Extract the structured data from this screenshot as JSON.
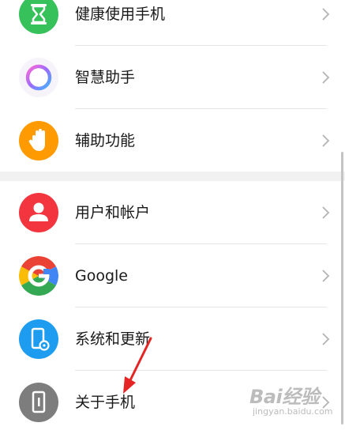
{
  "settings": {
    "items": [
      {
        "label": "健康使用手机",
        "icon": "hourglass-icon",
        "color": "#36c15a"
      },
      {
        "label": "智慧助手",
        "icon": "assistant-ring-icon",
        "color": "#7b6cf6"
      },
      {
        "label": "辅助功能",
        "icon": "hand-icon",
        "color": "#ff9b00"
      },
      {
        "label": "用户和帐户",
        "icon": "user-icon",
        "color": "#f2353f"
      },
      {
        "label": "Google",
        "icon": "google-icon",
        "color": "#4285f4"
      },
      {
        "label": "系统和更新",
        "icon": "phone-settings-icon",
        "color": "#1e9cf0"
      },
      {
        "label": "关于手机",
        "icon": "phone-info-icon",
        "color": "#7d7d7d"
      }
    ]
  },
  "annotation": {
    "arrow_color": "#e52524"
  },
  "watermark": {
    "logo": "Bai经验",
    "url": "jingyan.baidu.com"
  }
}
